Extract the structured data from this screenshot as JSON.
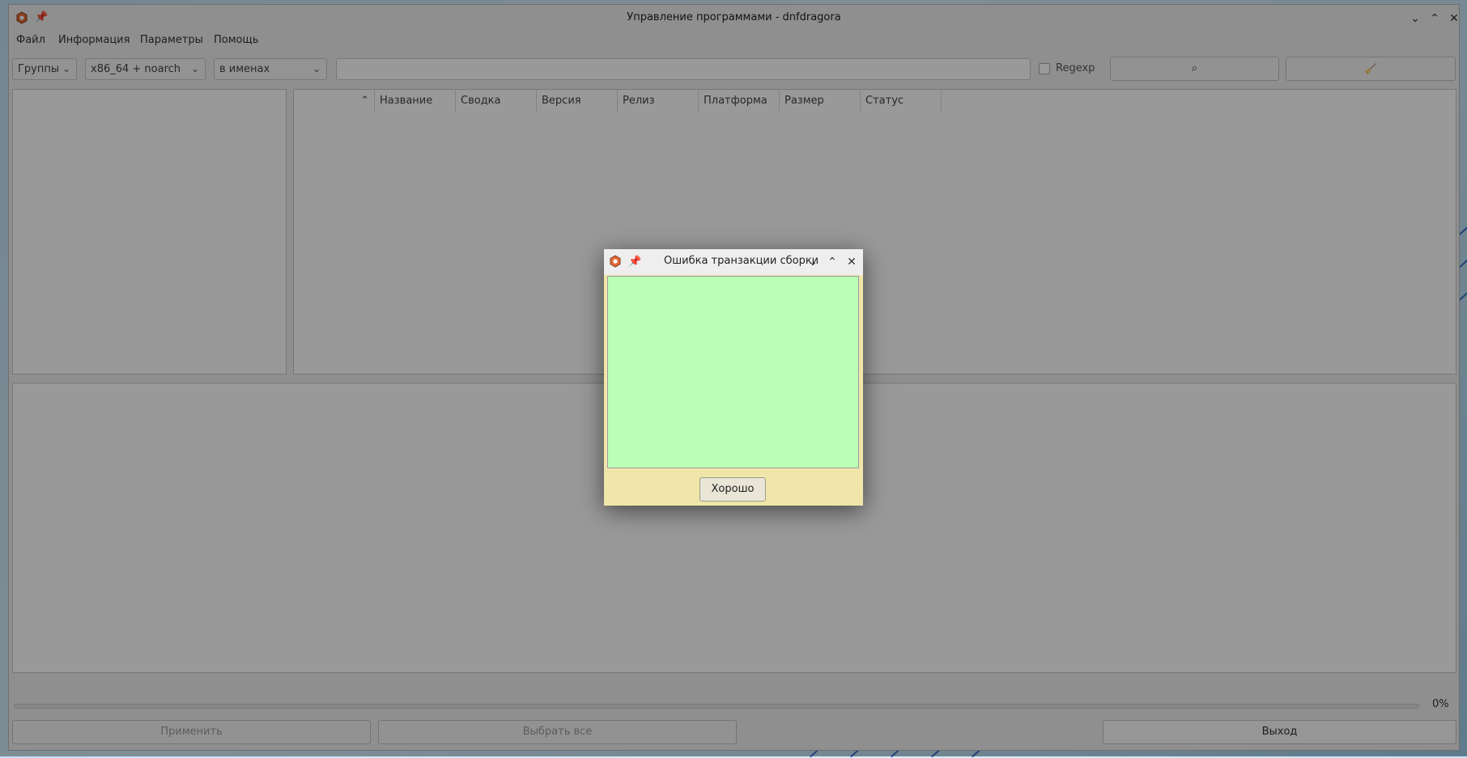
{
  "window": {
    "title": "Управление программами - dnfdragora",
    "pin_glyph": "📌",
    "minimize_glyph": "⌄",
    "maximize_glyph": "⌃",
    "close_glyph": "✕"
  },
  "menu": {
    "items": [
      "Файл",
      "Информация",
      "Параметры",
      "Помощь"
    ]
  },
  "toolbar": {
    "view_combo": "Группы",
    "arch_combo": "x86_64 + noarch",
    "search_in_combo": "в именах",
    "search_value": "",
    "regexp_label": "Regexp",
    "regexp_checked": false,
    "search_icon": "search-icon",
    "clear_icon": "broom-icon",
    "search_glyph": "⌕",
    "clear_glyph": "🧹",
    "chevron_glyph": "⌄"
  },
  "package_table": {
    "sort_glyph": "⌃",
    "columns": [
      "Название",
      "Сводка",
      "Версия",
      "Релиз",
      "Платформа",
      "Размер",
      "Статус"
    ]
  },
  "progress": {
    "value": 0,
    "label": "0%"
  },
  "buttons": {
    "apply": "Применить",
    "select_all": "Выбрать все",
    "exit": "Выход"
  },
  "dialog": {
    "title": "Ошибка транзакции сборки",
    "message": "",
    "ok_label": "Хорошо",
    "pin_glyph": "📌",
    "minimize_glyph": "⌄",
    "maximize_glyph": "⌃",
    "close_glyph": "✕"
  },
  "colors": {
    "dialog_background": "#f0e6aa",
    "dialog_text_area": "#bbffb6",
    "overlay": "rgba(0,0,0,0.40)"
  }
}
